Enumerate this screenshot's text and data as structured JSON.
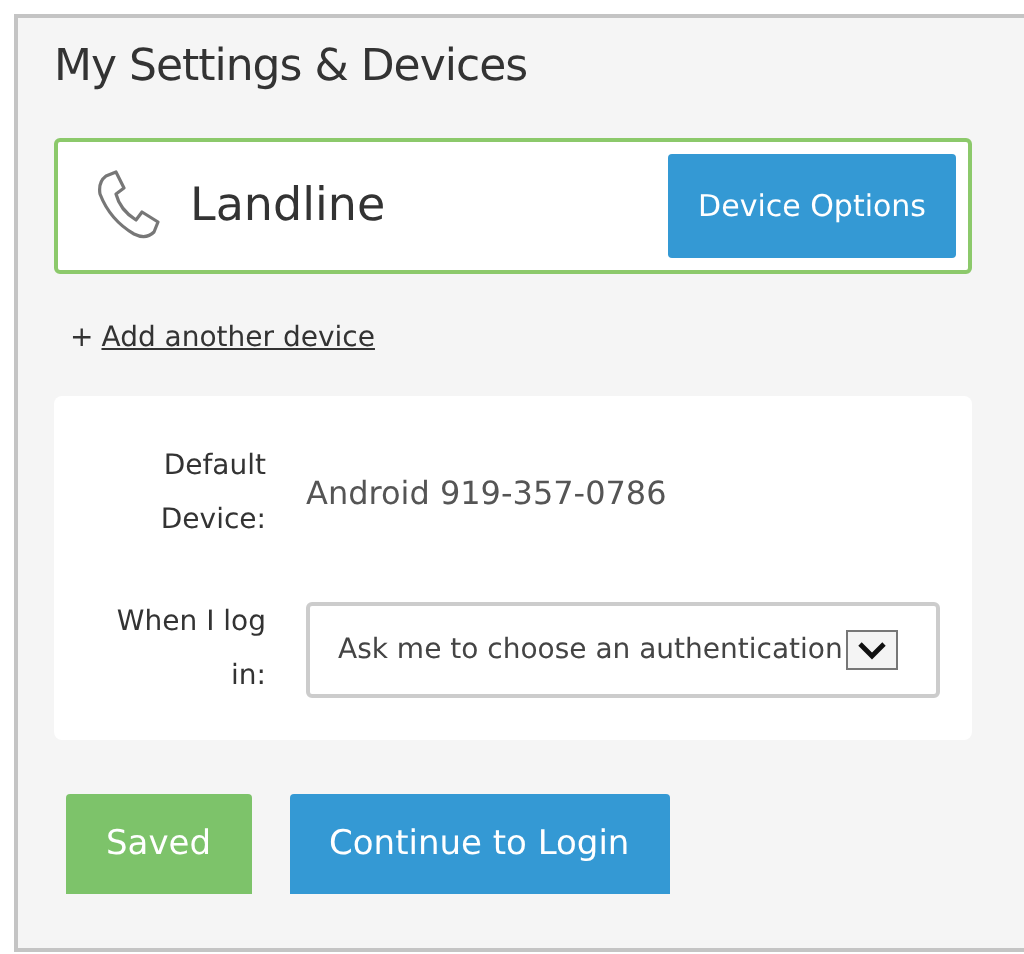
{
  "title": "My Settings & Devices",
  "device": {
    "name": "Landline",
    "button": "Device Options"
  },
  "add_link": {
    "prefix": "+",
    "label": "Add another device"
  },
  "settings": [
    {
      "kind": "value",
      "label": "Default Device:",
      "value": "Android 919-357-0786"
    },
    {
      "kind": "select",
      "label": "When I log in:",
      "value": "Ask me to choose an authentication"
    }
  ],
  "buttons": [
    {
      "label": "Saved",
      "kind": "success"
    },
    {
      "label": "Continue to Login",
      "kind": "primary"
    }
  ]
}
